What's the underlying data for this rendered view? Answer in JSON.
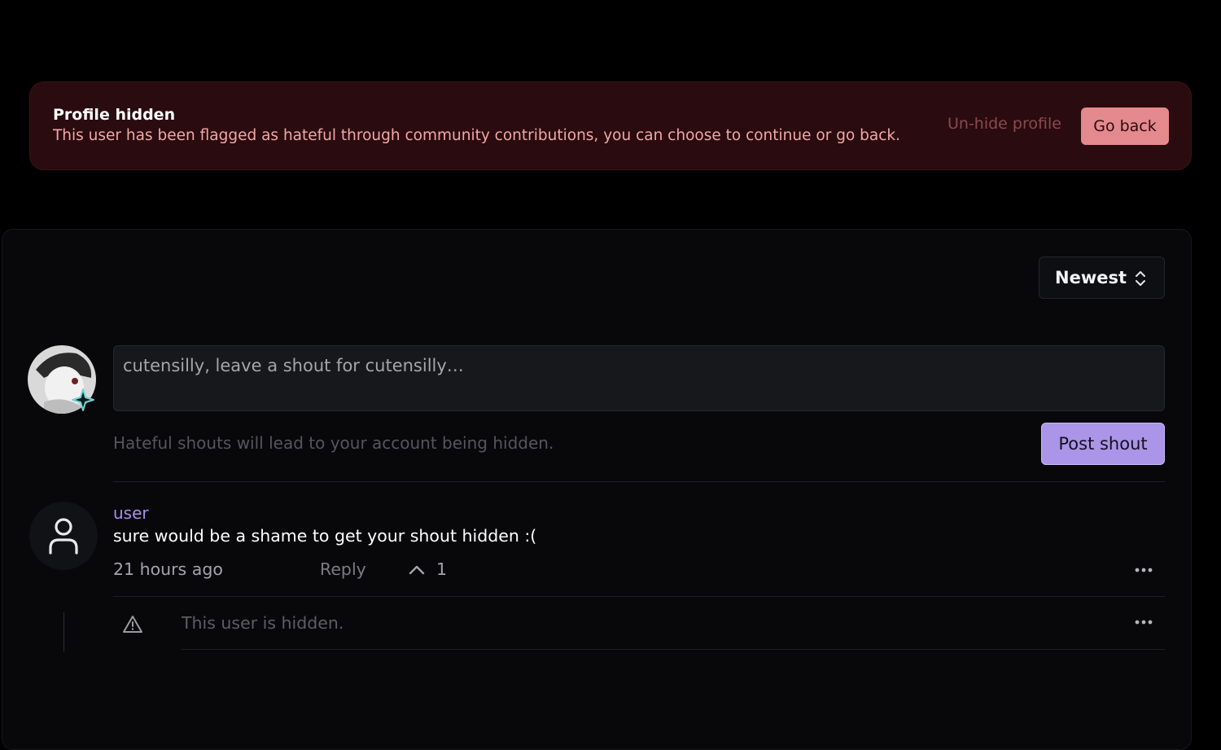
{
  "banner": {
    "title": "Profile hidden",
    "message": "This user has been flagged as hateful through community contributions, you can choose to continue or go back.",
    "unhide_label": "Un-hide profile",
    "goback_label": "Go back"
  },
  "sort": {
    "selected": "Newest",
    "icon": "chevron-up-down-icon"
  },
  "composer": {
    "placeholder": "cutensilly, leave a shout for cutensilly…",
    "hint": "Hateful shouts will lead to your account being hidden.",
    "post_label": "Post shout"
  },
  "comments": [
    {
      "username": "user",
      "text": "sure would be a shame to get your shout hidden :(",
      "timestamp": "21 hours ago",
      "reply_label": "Reply",
      "upvotes": "1",
      "replies": [
        {
          "text": "This user is hidden."
        }
      ]
    }
  ],
  "colors": {
    "banner_bg": "#2a0b0f",
    "banner_text": "#f2a7a7",
    "goback_bg": "#e4898d",
    "accent": "#ab95e8",
    "username": "#a88ff0"
  }
}
